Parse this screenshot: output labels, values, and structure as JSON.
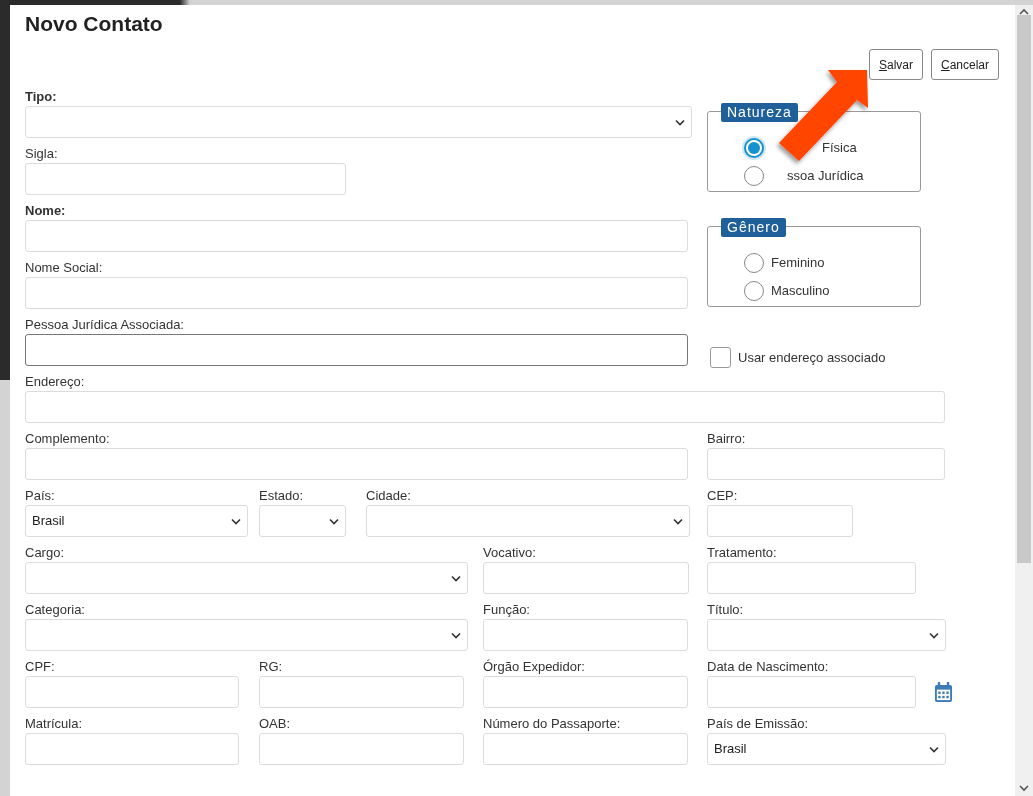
{
  "title": "Novo Contato",
  "buttons": [
    {
      "label": "Salvar",
      "first_letter_underlined": true
    },
    {
      "label": "Cancelar",
      "first_letter_underlined": true
    }
  ],
  "fields": [
    {
      "label": "Tipo:",
      "kind": "select",
      "bold": true,
      "focused": false
    },
    {
      "label": "Sigla:",
      "kind": "text",
      "bold": false,
      "focused": false
    },
    {
      "label": "Nome:",
      "kind": "text",
      "bold": true,
      "focused": false
    },
    {
      "label": "Nome Social:",
      "kind": "text",
      "bold": false,
      "focused": false
    },
    {
      "label": "Pessoa Jurídica Associada:",
      "kind": "text",
      "bold": false,
      "focused": true
    },
    {
      "label": "Endereço:",
      "kind": "text",
      "bold": false,
      "focused": false
    },
    {
      "label": "Complemento:",
      "kind": "text",
      "bold": false,
      "focused": false
    },
    {
      "label": "Bairro:",
      "kind": "text",
      "bold": false,
      "focused": false
    },
    {
      "label": "País:",
      "kind": "select",
      "value": "Brasil",
      "bold": false,
      "focused": false
    },
    {
      "label": "Estado:",
      "kind": "select",
      "bold": false,
      "focused": false
    },
    {
      "label": "Cidade:",
      "kind": "select",
      "bold": false,
      "focused": false
    },
    {
      "label": "CEP:",
      "kind": "text",
      "bold": false,
      "focused": false
    },
    {
      "label": "Cargo:",
      "kind": "select",
      "bold": false,
      "focused": false
    },
    {
      "label": "Vocativo:",
      "kind": "text",
      "bold": false,
      "focused": false
    },
    {
      "label": "Tratamento:",
      "kind": "text",
      "bold": false,
      "focused": false
    },
    {
      "label": "Categoria:",
      "kind": "select",
      "bold": false,
      "focused": false
    },
    {
      "label": "Função:",
      "kind": "text",
      "bold": false,
      "focused": false
    },
    {
      "label": "Título:",
      "kind": "select",
      "bold": false,
      "focused": false
    },
    {
      "label": "CPF:",
      "kind": "text",
      "bold": false,
      "focused": false
    },
    {
      "label": "RG:",
      "kind": "text",
      "bold": false,
      "focused": false
    },
    {
      "label": "Órgão Expedidor:",
      "kind": "text",
      "bold": false,
      "focused": false
    },
    {
      "label": "Data de Nascimento:",
      "kind": "date",
      "bold": false,
      "focused": false
    },
    {
      "label": "Matrícula:",
      "kind": "text",
      "bold": false,
      "focused": false
    },
    {
      "label": "OAB:",
      "kind": "text",
      "bold": false,
      "focused": false
    },
    {
      "label": "Número do Passaporte:",
      "kind": "text",
      "bold": false,
      "focused": false
    },
    {
      "label": "País de Emissão:",
      "kind": "select",
      "value": "Brasil",
      "bold": false,
      "focused": false
    }
  ],
  "groups": [
    {
      "legend": "Natureza",
      "options": [
        {
          "label": "Física",
          "selected": true
        },
        {
          "label": "ssoa Jurídica",
          "selected": false
        }
      ]
    },
    {
      "legend": "Gênero",
      "options": [
        {
          "label": "Feminino",
          "selected": false
        },
        {
          "label": "Masculino",
          "selected": false
        }
      ]
    }
  ],
  "checkbox": {
    "label": "Usar endereço associado",
    "checked": false
  }
}
